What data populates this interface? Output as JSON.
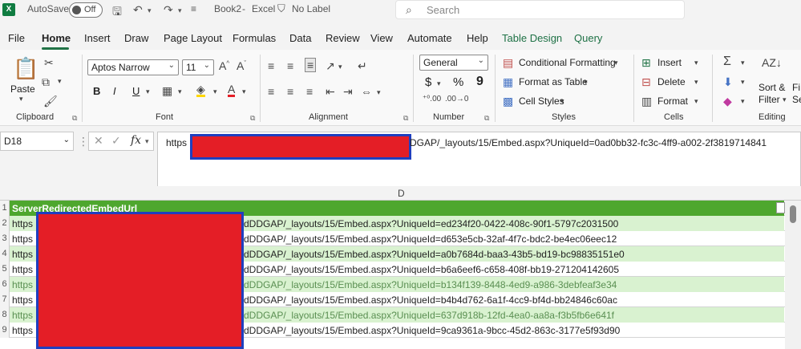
{
  "titlebar": {
    "autosave_label": "AutoSave",
    "autosave_state": "Off",
    "book_title": "Book2",
    "app_name": "Excel",
    "sensitivity": "No Label",
    "search_placeholder": "Search",
    "separator": "-"
  },
  "tabs": [
    {
      "label": "File"
    },
    {
      "label": "Home"
    },
    {
      "label": "Insert"
    },
    {
      "label": "Draw"
    },
    {
      "label": "Page Layout"
    },
    {
      "label": "Formulas"
    },
    {
      "label": "Data"
    },
    {
      "label": "Review"
    },
    {
      "label": "View"
    },
    {
      "label": "Automate"
    },
    {
      "label": "Help"
    },
    {
      "label": "Table Design"
    },
    {
      "label": "Query"
    }
  ],
  "ribbon": {
    "clipboard": {
      "paste": "Paste",
      "label": "Clipboard"
    },
    "font": {
      "name": "Aptos Narrow",
      "size": "11",
      "bold": "B",
      "italic": "I",
      "underline": "U",
      "label": "Font"
    },
    "alignment": {
      "label": "Alignment"
    },
    "number": {
      "format": "General",
      "currency": "$",
      "percent": "%",
      "comma": "9",
      "label": "Number"
    },
    "styles": {
      "conditional": "Conditional Formatting",
      "format_table": "Format as Table",
      "cell_styles": "Cell Styles",
      "label": "Styles"
    },
    "cells": {
      "insert": "Insert",
      "delete": "Delete",
      "format": "Format",
      "label": "Cells"
    },
    "editing": {
      "sort": "Sort &",
      "filter": "Filter",
      "find_1": "Fi",
      "find_2": "Se",
      "label": "Editing"
    }
  },
  "formula_bar": {
    "name_box": "D18",
    "fx": "fx",
    "prefix": "https",
    "suffix": "DGAP/_layouts/15/Embed.aspx?UniqueId=0ad0bb32-fc3c-4ff9-a002-2f3819714841"
  },
  "grid": {
    "column_label": "D",
    "rows": [
      {
        "num": "1",
        "pre": "ServerRedirectedEmbedUrl",
        "post": ""
      },
      {
        "num": "2",
        "pre": "https",
        "post": "dDDGAP/_layouts/15/Embed.aspx?UniqueId=ed234f20-0422-408c-90f1-5797c2031500"
      },
      {
        "num": "3",
        "pre": "https",
        "post": "dDDGAP/_layouts/15/Embed.aspx?UniqueId=d653e5cb-32af-4f7c-bdc2-be4ec06eec12"
      },
      {
        "num": "4",
        "pre": "https",
        "post": "dDDGAP/_layouts/15/Embed.aspx?UniqueId=a0b7684d-baa3-43b5-bd19-bc98835151e0"
      },
      {
        "num": "5",
        "pre": "https",
        "post": "dDDGAP/_layouts/15/Embed.aspx?UniqueId=b6a6eef6-c658-408f-bb19-271204142605"
      },
      {
        "num": "6",
        "pre": "https",
        "post": "dDDGAP/_layouts/15/Embed.aspx?UniqueId=b134f139-8448-4ed9-a986-3debfeaf3e34"
      },
      {
        "num": "7",
        "pre": "https",
        "post": "dDDGAP/_layouts/15/Embed.aspx?UniqueId=b4b4d762-6a1f-4cc9-bf4d-bb24846c60ac"
      },
      {
        "num": "8",
        "pre": "https",
        "post": "dDDGAP/_layouts/15/Embed.aspx?UniqueId=637d918b-12fd-4ea0-aa8a-f3b5fb6e641f"
      },
      {
        "num": "9",
        "pre": "https",
        "post": "dDDGAP/_layouts/15/Embed.aspx?UniqueId=9ca9361a-9bcc-45d2-863c-3177e5f93d90"
      }
    ]
  },
  "colors": {
    "table_header": "#4ea72e",
    "band": "#d9f2d0",
    "accent": "#217346",
    "redaction_fill": "#e41e26",
    "redaction_border": "#1f3fbf"
  }
}
